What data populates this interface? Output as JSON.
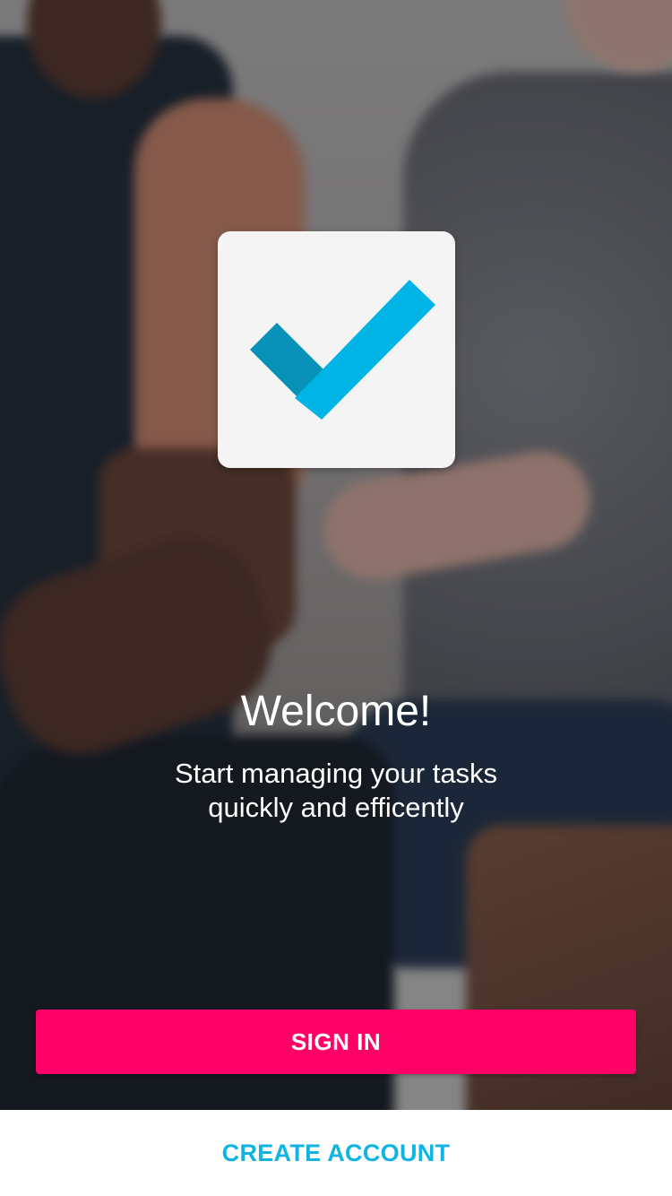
{
  "welcome": {
    "title": "Welcome!",
    "subtitle_line1": "Start managing your tasks",
    "subtitle_line2": "quickly and efficently"
  },
  "actions": {
    "sign_in_label": "SIGN IN",
    "create_account_label": "CREATE ACCOUNT"
  },
  "icons": {
    "app_logo": "checkmark-icon"
  },
  "colors": {
    "primary_button": "#ff0066",
    "link": "#10b4e3",
    "check_dark": "#0892b8",
    "check_light": "#00b5e6",
    "logo_card": "#f4f4f4"
  }
}
